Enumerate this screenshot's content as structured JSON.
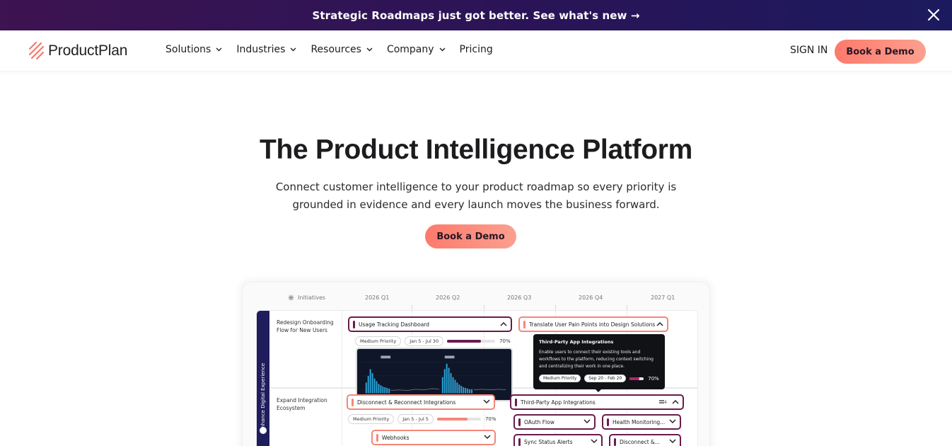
{
  "announcement": {
    "text": "Strategic Roadmaps just got better. See what's new →",
    "close_icon": "close-icon"
  },
  "nav": {
    "brand": "ProductPlan",
    "menu": [
      {
        "label": "Solutions"
      },
      {
        "label": "Industries"
      },
      {
        "label": "Resources"
      },
      {
        "label": "Company"
      },
      {
        "label": "Pricing"
      }
    ],
    "signin": "SIGN IN",
    "cta": "Book a Demo"
  },
  "hero": {
    "title": "The Product Intelligence Platform",
    "subtitle_line1": "Connect customer intelligence to your product roadmap so every priority is",
    "subtitle_line2": "grounded in evidence and every launch moves the business forward.",
    "cta": "Book a Demo"
  },
  "roadmap": {
    "initiatives_label": "Initiatives",
    "quarters": [
      "2026 Q1",
      "2026 Q2",
      "2026 Q3",
      "2026 Q4",
      "2027 Q1"
    ],
    "lane_label": "Enhance Digital Experience",
    "rows": [
      {
        "title_line1": "Redesign Onboarding",
        "title_line2": "Flow for New Users"
      },
      {
        "title_line1": "Expand Integration",
        "title_line2": "Ecosystem"
      }
    ],
    "bars": {
      "usage_tracking": {
        "label": "Usage Tracking Dashboard",
        "priority": "Medium Priority",
        "dates": "Jan 5 - Jul 30",
        "progress_pct": 70,
        "progress_text": "70%"
      },
      "translate": {
        "label": "Translate User Pain Points into Design Solutions"
      },
      "disconnect": {
        "label": "Disconnect & Reconnect Integrations",
        "priority": "Medium Priority",
        "dates": "Jan 5 - Jul 5",
        "progress_pct": 70,
        "progress_text": "70%"
      },
      "webhooks": {
        "label": "Webhooks"
      },
      "third_party": {
        "label": "Third-Party App Integrations",
        "count": "4"
      },
      "oauth": {
        "label": "OAuth Flow"
      },
      "health": {
        "label": "Health Monitoring..."
      },
      "sync": {
        "label": "Sync Status Alerts"
      },
      "disconnect_short": {
        "label": "Disconnect &..."
      }
    },
    "tooltip": {
      "title": "Third-Party App Integrations",
      "body": "Enable users to connect their existing tools and workflows to the platform, reducing context switching and centralizing their work in one place.",
      "priority": "Medium Priority",
      "dates": "Sep 20 - Feb 20",
      "progress_pct": 70,
      "progress_text": "70%"
    }
  },
  "colors": {
    "accent_coral": "#f58678",
    "plum": "#6a1b4d",
    "navy": "#1f1d5c",
    "announce_bg": "#2a1457"
  }
}
